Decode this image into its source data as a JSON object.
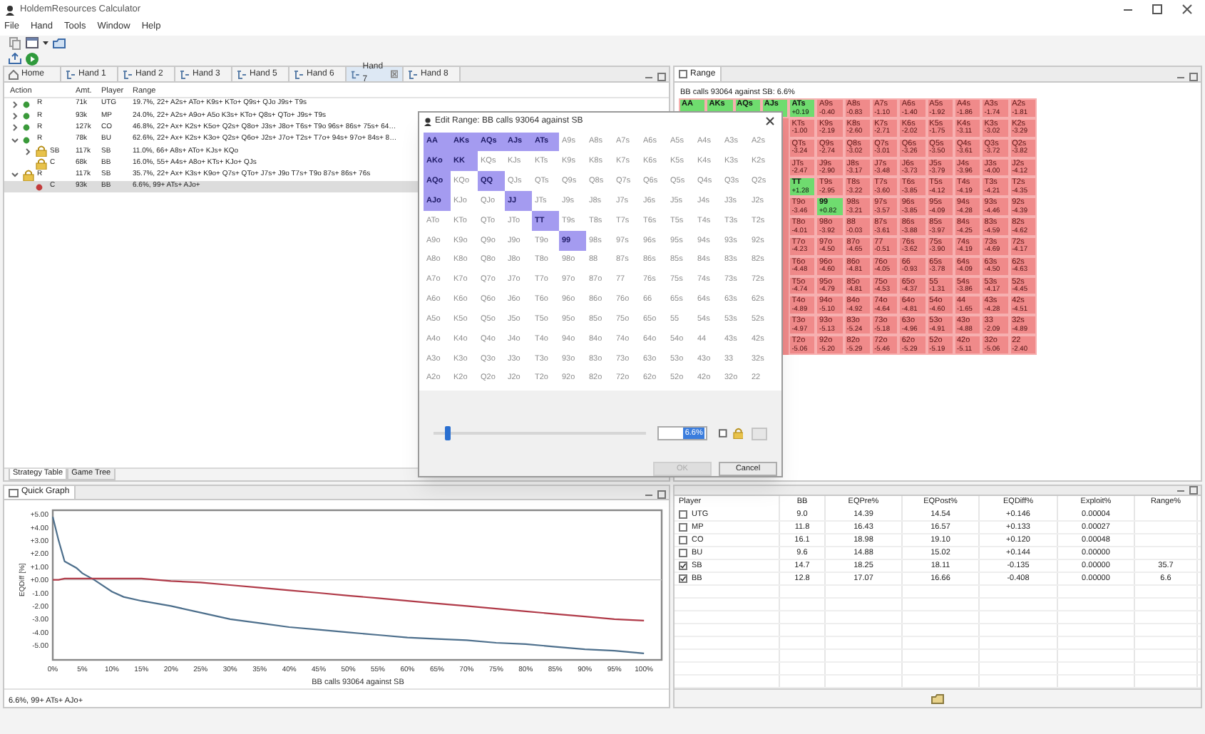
{
  "window": {
    "title": "HoldemResources Calculator"
  },
  "menu": [
    "File",
    "Hand",
    "Tools",
    "Window",
    "Help"
  ],
  "tabs": [
    {
      "label": "Home",
      "kind": "home",
      "selected": false
    },
    {
      "label": "Hand 1",
      "kind": "hand",
      "selected": false
    },
    {
      "label": "Hand 2",
      "kind": "hand",
      "selected": false
    },
    {
      "label": "Hand 3",
      "kind": "hand",
      "selected": false
    },
    {
      "label": "Hand 5",
      "kind": "hand",
      "selected": false
    },
    {
      "label": "Hand 6",
      "kind": "hand",
      "selected": false
    },
    {
      "label": "Hand 7",
      "kind": "hand",
      "selected": true
    },
    {
      "label": "Hand 8",
      "kind": "hand",
      "selected": false
    }
  ],
  "tree": {
    "columns": [
      "Action",
      "Amt.",
      "Player",
      "Range"
    ],
    "nodes": [
      {
        "action": "R",
        "amount": "71k",
        "player": "UTG",
        "range": "19.7%, 22+ A2s+ ATo+ K9s+ KTo+ Q9s+ QJo J9s+ T9s",
        "kind": "dot",
        "color": "#3a9a3a",
        "expanded": false,
        "selected": false
      },
      {
        "action": "R",
        "amount": "93k",
        "player": "MP",
        "range": "24.0%, 22+ A2s+ A9o+ A5o K3s+ KTo+ Q8s+ QTo+ J9s+ T9s",
        "kind": "dot",
        "color": "#3a9a3a",
        "expanded": false,
        "selected": false
      },
      {
        "action": "R",
        "amount": "127k",
        "player": "CO",
        "range": "46.8%, 22+ Ax+ K2s+ K5o+ Q2s+ Q8o+ J3s+ J8o+ T6s+ T9o 96s+ 86s+ 75s+ 64…",
        "kind": "dot",
        "color": "#3a9a3a",
        "expanded": false,
        "selected": false
      },
      {
        "action": "R",
        "amount": "78k",
        "player": "BU",
        "range": "62.6%, 22+ Ax+ K2s+ K3o+ Q2s+ Q6o+ J2s+ J7o+ T2s+ T7o+ 94s+ 97o+ 84s+ 8…",
        "kind": "dot",
        "color": "#3a9a3a",
        "expanded": true,
        "selected": false,
        "children": [
          {
            "action": "SB",
            "amount": "117k",
            "player": "SB",
            "range": "11.0%, 66+ A8s+ ATo+ KJs+ KQo",
            "kind": "lock",
            "expanded": false,
            "selected": false
          },
          {
            "action": "C",
            "amount": "68k",
            "player": "BB",
            "range": "16.0%, 55+ A4s+ A8o+ KTs+ KJo+ QJs",
            "kind": "lock",
            "selected": false
          }
        ]
      },
      {
        "action": "R",
        "amount": "117k",
        "player": "SB",
        "range": "35.7%, 22+ Ax+ K3s+ K9o+ Q7s+ QTo+ J7s+ J9o T7s+ T9o 87s+ 86s+ 76s",
        "kind": "lock",
        "expanded": true,
        "selected": false,
        "children": [
          {
            "action": "C",
            "amount": "93k",
            "player": "BB",
            "range": "6.6%, 99+ ATs+ AJo+",
            "kind": "dot",
            "color": "#c23b3b",
            "selected": true
          }
        ]
      }
    ]
  },
  "bottom_tabs": [
    {
      "label": "Strategy Table",
      "selected": true
    },
    {
      "label": "Game Tree",
      "selected": false
    }
  ],
  "quick_graph": {
    "tab": "Quick Graph",
    "chart_data": {
      "type": "line",
      "xlabel": "BB calls 93064 against SB",
      "ylabel": "EQDiff [%]",
      "x": [
        0,
        1,
        2,
        4,
        5,
        7,
        10,
        12,
        15,
        20,
        25,
        30,
        35,
        40,
        45,
        50,
        55,
        60,
        65,
        70,
        75,
        80,
        85,
        90,
        95,
        100
      ],
      "series": [
        {
          "color": "#4d6f8c",
          "values": [
            4.8,
            3.0,
            1.4,
            0.9,
            0.5,
            0.0,
            -0.9,
            -1.3,
            -1.6,
            -2.0,
            -2.5,
            -3.0,
            -3.3,
            -3.6,
            -3.8,
            -4.0,
            -4.2,
            -4.4,
            -4.5,
            -4.6,
            -4.8,
            -4.9,
            -5.1,
            -5.3,
            -5.4,
            -5.6
          ]
        },
        {
          "color": "#b03a48",
          "values": [
            0.0,
            0.0,
            0.1,
            0.1,
            0.1,
            0.1,
            0.1,
            0.1,
            0.1,
            -0.1,
            -0.2,
            -0.4,
            -0.6,
            -0.8,
            -1.0,
            -1.2,
            -1.4,
            -1.6,
            -1.8,
            -2.0,
            -2.2,
            -2.4,
            -2.6,
            -2.8,
            -3.0,
            -3.1
          ]
        }
      ],
      "xlim": [
        0,
        103
      ],
      "ylim": [
        -6.1,
        5.3
      ],
      "xticks": [
        {
          "value": 0,
          "label": "0%"
        },
        {
          "value": 5,
          "label": "5%"
        },
        {
          "value": 10,
          "label": "10%"
        },
        {
          "value": 15,
          "label": "15%"
        },
        {
          "value": 20,
          "label": "20%"
        },
        {
          "value": 25,
          "label": "25%"
        },
        {
          "value": 30,
          "label": "30%"
        },
        {
          "value": 35,
          "label": "35%"
        },
        {
          "value": 40,
          "label": "40%"
        },
        {
          "value": 45,
          "label": "45%"
        },
        {
          "value": 50,
          "label": "50%"
        },
        {
          "value": 55,
          "label": "55%"
        },
        {
          "value": 60,
          "label": "60%"
        },
        {
          "value": 65,
          "label": "65%"
        },
        {
          "value": 70,
          "label": "70%"
        },
        {
          "value": 75,
          "label": "75%"
        },
        {
          "value": 80,
          "label": "80%"
        },
        {
          "value": 85,
          "label": "85%"
        },
        {
          "value": 90,
          "label": "90%"
        },
        {
          "value": 95,
          "label": "95%"
        },
        {
          "value": 100,
          "label": "100%"
        }
      ],
      "yticks": [
        {
          "value": 5,
          "label": "+5.00"
        },
        {
          "value": 4,
          "label": "+4.00"
        },
        {
          "value": 3,
          "label": "+3.00"
        },
        {
          "value": 2,
          "label": "+2.00"
        },
        {
          "value": 1,
          "label": "+1.00"
        },
        {
          "value": 0,
          "label": "+0.00"
        },
        {
          "value": -1,
          "label": "-1.00"
        },
        {
          "value": -2,
          "label": "-2.00"
        },
        {
          "value": -3,
          "label": "-3.00"
        },
        {
          "value": -4,
          "label": "-4.00"
        },
        {
          "value": -5,
          "label": "-5.00"
        }
      ]
    }
  },
  "status_text": "6.6%, 99+ ATs+ AJo+",
  "range_panel": {
    "tab": "Range",
    "subtitle": "BB calls 93064 against SB: 6.6%",
    "rows": [
      [
        {
          "hand": "AA",
          "selected": true
        },
        {
          "hand": "AKs",
          "selected": true
        },
        {
          "hand": "AQs",
          "selected": true
        },
        {
          "hand": "AJs",
          "selected": true
        },
        {
          "hand": "ATs",
          "ev": "+0.19",
          "selected": true
        },
        {
          "hand": "A9s",
          "ev": "-0.40",
          "selected": false
        },
        {
          "hand": "A8s",
          "ev": "-0.83",
          "selected": false
        },
        {
          "hand": "A7s",
          "ev": "-1.10",
          "selected": false
        },
        {
          "hand": "A6s",
          "ev": "-1.40",
          "selected": false
        },
        {
          "hand": "A5s",
          "ev": "-1.92",
          "selected": false
        },
        {
          "hand": "A4s",
          "ev": "-1.86",
          "selected": false
        },
        {
          "hand": "A3s",
          "ev": "-1.74",
          "selected": false
        },
        {
          "hand": "A2s",
          "ev": "-1.81",
          "selected": false
        }
      ],
      [
        "",
        "",
        "",
        "",
        {
          "hand": "KTs",
          "ev": "-1.00",
          "selected": false
        },
        {
          "hand": "K9s",
          "ev": "-2.19",
          "selected": false
        },
        {
          "hand": "K8s",
          "ev": "-2.60",
          "selected": false
        },
        {
          "hand": "K7s",
          "ev": "-2.71",
          "selected": false
        },
        {
          "hand": "K6s",
          "ev": "-2.02",
          "selected": false
        },
        {
          "hand": "K5s",
          "ev": "-1.75",
          "selected": false
        },
        {
          "hand": "K4s",
          "ev": "-3.11",
          "selected": false
        },
        {
          "hand": "K3s",
          "ev": "-3.02",
          "selected": false
        },
        {
          "hand": "K2s",
          "ev": "-3.29",
          "selected": false
        }
      ],
      [
        "",
        "",
        "",
        "",
        {
          "hand": "QTs",
          "ev": "-3.24",
          "selected": false
        },
        {
          "hand": "Q9s",
          "ev": "-2.74",
          "selected": false
        },
        {
          "hand": "Q8s",
          "ev": "-3.02",
          "selected": false
        },
        {
          "hand": "Q7s",
          "ev": "-3.01",
          "selected": false
        },
        {
          "hand": "Q6s",
          "ev": "-3.26",
          "selected": false
        },
        {
          "hand": "Q5s",
          "ev": "-3.50",
          "selected": false
        },
        {
          "hand": "Q4s",
          "ev": "-3.61",
          "selected": false
        },
        {
          "hand": "Q3s",
          "ev": "-3.72",
          "selected": false
        },
        {
          "hand": "Q2s",
          "ev": "-3.82",
          "selected": false
        }
      ],
      [
        "",
        "",
        "",
        "",
        {
          "hand": "JTs",
          "ev": "-2.47",
          "selected": false
        },
        {
          "hand": "J9s",
          "ev": "-2.90",
          "selected": false
        },
        {
          "hand": "J8s",
          "ev": "-3.17",
          "selected": false
        },
        {
          "hand": "J7s",
          "ev": "-3.48",
          "selected": false
        },
        {
          "hand": "J6s",
          "ev": "-3.73",
          "selected": false
        },
        {
          "hand": "J5s",
          "ev": "-3.79",
          "selected": false
        },
        {
          "hand": "J4s",
          "ev": "-3.96",
          "selected": false
        },
        {
          "hand": "J3s",
          "ev": "-4.00",
          "selected": false
        },
        {
          "hand": "J2s",
          "ev": "-4.12",
          "selected": false
        }
      ],
      [
        "",
        "",
        "",
        "",
        {
          "hand": "TT",
          "ev": "+1.28",
          "selected": true
        },
        {
          "hand": "T9s",
          "ev": "-2.95",
          "selected": false
        },
        {
          "hand": "T8s",
          "ev": "-3.22",
          "selected": false
        },
        {
          "hand": "T7s",
          "ev": "-3.60",
          "selected": false
        },
        {
          "hand": "T6s",
          "ev": "-3.85",
          "selected": false
        },
        {
          "hand": "T5s",
          "ev": "-4.12",
          "selected": false
        },
        {
          "hand": "T4s",
          "ev": "-4.19",
          "selected": false
        },
        {
          "hand": "T3s",
          "ev": "-4.21",
          "selected": false
        },
        {
          "hand": "T2s",
          "ev": "-4.35",
          "selected": false
        }
      ],
      [
        "",
        "",
        "",
        "",
        {
          "hand": "T9o",
          "ev": "-3.46",
          "selected": false
        },
        {
          "hand": "99",
          "ev": "+0.82",
          "selected": true
        },
        {
          "hand": "98s",
          "ev": "-3.21",
          "selected": false
        },
        {
          "hand": "97s",
          "ev": "-3.57",
          "selected": false
        },
        {
          "hand": "96s",
          "ev": "-3.85",
          "selected": false
        },
        {
          "hand": "95s",
          "ev": "-4.09",
          "selected": false
        },
        {
          "hand": "94s",
          "ev": "-4.28",
          "selected": false
        },
        {
          "hand": "93s",
          "ev": "-4.46",
          "selected": false
        },
        {
          "hand": "92s",
          "ev": "-4.39",
          "selected": false
        }
      ],
      [
        "",
        "",
        "",
        "",
        {
          "hand": "T8o",
          "ev": "-4.01",
          "selected": false
        },
        {
          "hand": "98o",
          "ev": "-3.92",
          "selected": false
        },
        {
          "hand": "88",
          "ev": "-0.03",
          "selected": false
        },
        {
          "hand": "87s",
          "ev": "-3.61",
          "selected": false
        },
        {
          "hand": "86s",
          "ev": "-3.88",
          "selected": false
        },
        {
          "hand": "85s",
          "ev": "-3.97",
          "selected": false
        },
        {
          "hand": "84s",
          "ev": "-4.25",
          "selected": false
        },
        {
          "hand": "83s",
          "ev": "-4.59",
          "selected": false
        },
        {
          "hand": "82s",
          "ev": "-4.62",
          "selected": false
        }
      ],
      [
        "",
        "",
        "",
        "",
        {
          "hand": "T7o",
          "ev": "-4.23",
          "selected": false
        },
        {
          "hand": "97o",
          "ev": "-4.50",
          "selected": false
        },
        {
          "hand": "87o",
          "ev": "-4.65",
          "selected": false
        },
        {
          "hand": "77",
          "ev": "-0.51",
          "selected": false
        },
        {
          "hand": "76s",
          "ev": "-3.62",
          "selected": false
        },
        {
          "hand": "75s",
          "ev": "-3.90",
          "selected": false
        },
        {
          "hand": "74s",
          "ev": "-4.19",
          "selected": false
        },
        {
          "hand": "73s",
          "ev": "-4.69",
          "selected": false
        },
        {
          "hand": "72s",
          "ev": "-4.17",
          "selected": false
        }
      ],
      [
        "",
        "",
        "",
        "",
        {
          "hand": "T6o",
          "ev": "-4.48",
          "selected": false
        },
        {
          "hand": "96o",
          "ev": "-4.60",
          "selected": false
        },
        {
          "hand": "86o",
          "ev": "-4.81",
          "selected": false
        },
        {
          "hand": "76o",
          "ev": "-4.05",
          "selected": false
        },
        {
          "hand": "66",
          "ev": "-0.93",
          "selected": false
        },
        {
          "hand": "65s",
          "ev": "-3.78",
          "selected": false
        },
        {
          "hand": "64s",
          "ev": "-4.09",
          "selected": false
        },
        {
          "hand": "63s",
          "ev": "-4.50",
          "selected": false
        },
        {
          "hand": "62s",
          "ev": "-4.63",
          "selected": false
        }
      ],
      [
        "",
        "",
        "",
        "",
        {
          "hand": "T5o",
          "ev": "-4.74",
          "selected": false
        },
        {
          "hand": "95o",
          "ev": "-4.79",
          "selected": false
        },
        {
          "hand": "85o",
          "ev": "-4.81",
          "selected": false
        },
        {
          "hand": "75o",
          "ev": "-4.53",
          "selected": false
        },
        {
          "hand": "65o",
          "ev": "-4.37",
          "selected": false
        },
        {
          "hand": "55",
          "ev": "-1.31",
          "selected": false
        },
        {
          "hand": "54s",
          "ev": "-3.86",
          "selected": false
        },
        {
          "hand": "53s",
          "ev": "-4.17",
          "selected": false
        },
        {
          "hand": "52s",
          "ev": "-4.45",
          "selected": false
        }
      ],
      [
        "",
        "",
        "",
        "",
        {
          "hand": "T4o",
          "ev": "-4.89",
          "selected": false
        },
        {
          "hand": "94o",
          "ev": "-5.10",
          "selected": false
        },
        {
          "hand": "84o",
          "ev": "-4.92",
          "selected": false
        },
        {
          "hand": "74o",
          "ev": "-4.64",
          "selected": false
        },
        {
          "hand": "64o",
          "ev": "-4.81",
          "selected": false
        },
        {
          "hand": "54o",
          "ev": "-4.60",
          "selected": false
        },
        {
          "hand": "44",
          "ev": "-1.65",
          "selected": false
        },
        {
          "hand": "43s",
          "ev": "-4.28",
          "selected": false
        },
        {
          "hand": "42s",
          "ev": "-4.51",
          "selected": false
        }
      ],
      [
        "",
        "",
        "",
        "",
        {
          "hand": "T3o",
          "ev": "-4.97",
          "selected": false
        },
        {
          "hand": "93o",
          "ev": "-5.13",
          "selected": false
        },
        {
          "hand": "83o",
          "ev": "-5.24",
          "selected": false
        },
        {
          "hand": "73o",
          "ev": "-5.18",
          "selected": false
        },
        {
          "hand": "63o",
          "ev": "-4.96",
          "selected": false
        },
        {
          "hand": "53o",
          "ev": "-4.91",
          "selected": false
        },
        {
          "hand": "43o",
          "ev": "-4.88",
          "selected": false
        },
        {
          "hand": "33",
          "ev": "-2.09",
          "selected": false
        },
        {
          "hand": "32s",
          "ev": "-4.89",
          "selected": false
        }
      ],
      [
        "",
        "",
        "",
        "",
        {
          "hand": "T2o",
          "ev": "-5.06",
          "selected": false
        },
        {
          "hand": "92o",
          "ev": "-5.20",
          "selected": false
        },
        {
          "hand": "82o",
          "ev": "-5.29",
          "selected": false
        },
        {
          "hand": "72o",
          "ev": "-5.46",
          "selected": false
        },
        {
          "hand": "62o",
          "ev": "-5.29",
          "selected": false
        },
        {
          "hand": "52o",
          "ev": "-5.19",
          "selected": false
        },
        {
          "hand": "42o",
          "ev": "-5.11",
          "selected": false
        },
        {
          "hand": "32o",
          "ev": "-5.06",
          "selected": false
        },
        {
          "hand": "22",
          "ev": "-2.40",
          "selected": false
        }
      ]
    ]
  },
  "stats_table": {
    "columns": [
      "Player",
      "BB",
      "EQPre%",
      "EQPost%",
      "EQDiff%",
      "Exploit%",
      "Range%"
    ],
    "rows": [
      {
        "checked": false,
        "cells": [
          "UTG",
          "9.0",
          "14.39",
          "14.54",
          "+0.146",
          "0.00004",
          ""
        ]
      },
      {
        "checked": false,
        "cells": [
          "MP",
          "11.8",
          "16.43",
          "16.57",
          "+0.133",
          "0.00027",
          ""
        ]
      },
      {
        "checked": false,
        "cells": [
          "CO",
          "16.1",
          "18.98",
          "19.10",
          "+0.120",
          "0.00048",
          ""
        ]
      },
      {
        "checked": false,
        "cells": [
          "BU",
          "9.6",
          "14.88",
          "15.02",
          "+0.144",
          "0.00000",
          ""
        ]
      },
      {
        "checked": true,
        "cells": [
          "SB",
          "14.7",
          "18.25",
          "18.11",
          "-0.135",
          "0.00000",
          "35.7"
        ]
      },
      {
        "checked": true,
        "cells": [
          "BB",
          "12.8",
          "17.07",
          "16.66",
          "-0.408",
          "0.00000",
          "6.6"
        ]
      }
    ]
  },
  "dialog": {
    "title": "Edit Range: BB calls 93064 against SB",
    "slider": {
      "level": 0.05
    },
    "percent": "6.6%",
    "lock_checked": false,
    "ok_disabled": true,
    "buttons": [
      "OK",
      "Cancel"
    ],
    "grid": [
      [
        {
          "hand": "AA",
          "selected": true
        },
        {
          "hand": "AKs",
          "selected": true
        },
        {
          "hand": "AQs",
          "selected": true
        },
        {
          "hand": "AJs",
          "selected": true
        },
        {
          "hand": "ATs",
          "selected": true
        },
        {
          "hand": "A9s",
          "selected": false
        },
        {
          "hand": "A8s",
          "selected": false
        },
        {
          "hand": "A7s",
          "selected": false
        },
        {
          "hand": "A6s",
          "selected": false
        },
        {
          "hand": "A5s",
          "selected": false
        },
        {
          "hand": "A4s",
          "selected": false
        },
        {
          "hand": "A3s",
          "selected": false
        },
        {
          "hand": "A2s",
          "selected": false
        }
      ],
      [
        {
          "hand": "AKo",
          "selected": true
        },
        {
          "hand": "KK",
          "selected": true
        },
        {
          "hand": "KQs",
          "selected": false
        },
        {
          "hand": "KJs",
          "selected": false
        },
        {
          "hand": "KTs",
          "selected": false
        },
        {
          "hand": "K9s",
          "selected": false
        },
        {
          "hand": "K8s",
          "selected": false
        },
        {
          "hand": "K7s",
          "selected": false
        },
        {
          "hand": "K6s",
          "selected": false
        },
        {
          "hand": "K5s",
          "selected": false
        },
        {
          "hand": "K4s",
          "selected": false
        },
        {
          "hand": "K3s",
          "selected": false
        },
        {
          "hand": "K2s",
          "selected": false
        }
      ],
      [
        {
          "hand": "AQo",
          "selected": true
        },
        {
          "hand": "KQo",
          "selected": false
        },
        {
          "hand": "QQ",
          "selected": true
        },
        {
          "hand": "QJs",
          "selected": false
        },
        {
          "hand": "QTs",
          "selected": false
        },
        {
          "hand": "Q9s",
          "selected": false
        },
        {
          "hand": "Q8s",
          "selected": false
        },
        {
          "hand": "Q7s",
          "selected": false
        },
        {
          "hand": "Q6s",
          "selected": false
        },
        {
          "hand": "Q5s",
          "selected": false
        },
        {
          "hand": "Q4s",
          "selected": false
        },
        {
          "hand": "Q3s",
          "selected": false
        },
        {
          "hand": "Q2s",
          "selected": false
        }
      ],
      [
        {
          "hand": "AJo",
          "selected": true
        },
        {
          "hand": "KJo",
          "selected": false
        },
        {
          "hand": "QJo",
          "selected": false
        },
        {
          "hand": "JJ",
          "selected": true
        },
        {
          "hand": "JTs",
          "selected": false
        },
        {
          "hand": "J9s",
          "selected": false
        },
        {
          "hand": "J8s",
          "selected": false
        },
        {
          "hand": "J7s",
          "selected": false
        },
        {
          "hand": "J6s",
          "selected": false
        },
        {
          "hand": "J5s",
          "selected": false
        },
        {
          "hand": "J4s",
          "selected": false
        },
        {
          "hand": "J3s",
          "selected": false
        },
        {
          "hand": "J2s",
          "selected": false
        }
      ],
      [
        {
          "hand": "ATo",
          "selected": false
        },
        {
          "hand": "KTo",
          "selected": false
        },
        {
          "hand": "QTo",
          "selected": false
        },
        {
          "hand": "JTo",
          "selected": false
        },
        {
          "hand": "TT",
          "selected": true
        },
        {
          "hand": "T9s",
          "selected": false
        },
        {
          "hand": "T8s",
          "selected": false
        },
        {
          "hand": "T7s",
          "selected": false
        },
        {
          "hand": "T6s",
          "selected": false
        },
        {
          "hand": "T5s",
          "selected": false
        },
        {
          "hand": "T4s",
          "selected": false
        },
        {
          "hand": "T3s",
          "selected": false
        },
        {
          "hand": "T2s",
          "selected": false
        }
      ],
      [
        {
          "hand": "A9o",
          "selected": false
        },
        {
          "hand": "K9o",
          "selected": false
        },
        {
          "hand": "Q9o",
          "selected": false
        },
        {
          "hand": "J9o",
          "selected": false
        },
        {
          "hand": "T9o",
          "selected": false
        },
        {
          "hand": "99",
          "selected": true
        },
        {
          "hand": "98s",
          "selected": false
        },
        {
          "hand": "97s",
          "selected": false
        },
        {
          "hand": "96s",
          "selected": false
        },
        {
          "hand": "95s",
          "selected": false
        },
        {
          "hand": "94s",
          "selected": false
        },
        {
          "hand": "93s",
          "selected": false
        },
        {
          "hand": "92s",
          "selected": false
        }
      ],
      [
        {
          "hand": "A8o",
          "selected": false
        },
        {
          "hand": "K8o",
          "selected": false
        },
        {
          "hand": "Q8o",
          "selected": false
        },
        {
          "hand": "J8o",
          "selected": false
        },
        {
          "hand": "T8o",
          "selected": false
        },
        {
          "hand": "98o",
          "selected": false
        },
        {
          "hand": "88",
          "selected": false
        },
        {
          "hand": "87s",
          "selected": false
        },
        {
          "hand": "86s",
          "selected": false
        },
        {
          "hand": "85s",
          "selected": false
        },
        {
          "hand": "84s",
          "selected": false
        },
        {
          "hand": "83s",
          "selected": false
        },
        {
          "hand": "82s",
          "selected": false
        }
      ],
      [
        {
          "hand": "A7o",
          "selected": false
        },
        {
          "hand": "K7o",
          "selected": false
        },
        {
          "hand": "Q7o",
          "selected": false
        },
        {
          "hand": "J7o",
          "selected": false
        },
        {
          "hand": "T7o",
          "selected": false
        },
        {
          "hand": "97o",
          "selected": false
        },
        {
          "hand": "87o",
          "selected": false
        },
        {
          "hand": "77",
          "selected": false
        },
        {
          "hand": "76s",
          "selected": false
        },
        {
          "hand": "75s",
          "selected": false
        },
        {
          "hand": "74s",
          "selected": false
        },
        {
          "hand": "73s",
          "selected": false
        },
        {
          "hand": "72s",
          "selected": false
        }
      ],
      [
        {
          "hand": "A6o",
          "selected": false
        },
        {
          "hand": "K6o",
          "selected": false
        },
        {
          "hand": "Q6o",
          "selected": false
        },
        {
          "hand": "J6o",
          "selected": false
        },
        {
          "hand": "T6o",
          "selected": false
        },
        {
          "hand": "96o",
          "selected": false
        },
        {
          "hand": "86o",
          "selected": false
        },
        {
          "hand": "76o",
          "selected": false
        },
        {
          "hand": "66",
          "selected": false
        },
        {
          "hand": "65s",
          "selected": false
        },
        {
          "hand": "64s",
          "selected": false
        },
        {
          "hand": "63s",
          "selected": false
        },
        {
          "hand": "62s",
          "selected": false
        }
      ],
      [
        {
          "hand": "A5o",
          "selected": false
        },
        {
          "hand": "K5o",
          "selected": false
        },
        {
          "hand": "Q5o",
          "selected": false
        },
        {
          "hand": "J5o",
          "selected": false
        },
        {
          "hand": "T5o",
          "selected": false
        },
        {
          "hand": "95o",
          "selected": false
        },
        {
          "hand": "85o",
          "selected": false
        },
        {
          "hand": "75o",
          "selected": false
        },
        {
          "hand": "65o",
          "selected": false
        },
        {
          "hand": "55",
          "selected": false
        },
        {
          "hand": "54s",
          "selected": false
        },
        {
          "hand": "53s",
          "selected": false
        },
        {
          "hand": "52s",
          "selected": false
        }
      ],
      [
        {
          "hand": "A4o",
          "selected": false
        },
        {
          "hand": "K4o",
          "selected": false
        },
        {
          "hand": "Q4o",
          "selected": false
        },
        {
          "hand": "J4o",
          "selected": false
        },
        {
          "hand": "T4o",
          "selected": false
        },
        {
          "hand": "94o",
          "selected": false
        },
        {
          "hand": "84o",
          "selected": false
        },
        {
          "hand": "74o",
          "selected": false
        },
        {
          "hand": "64o",
          "selected": false
        },
        {
          "hand": "54o",
          "selected": false
        },
        {
          "hand": "44",
          "selected": false
        },
        {
          "hand": "43s",
          "selected": false
        },
        {
          "hand": "42s",
          "selected": false
        }
      ],
      [
        {
          "hand": "A3o",
          "selected": false
        },
        {
          "hand": "K3o",
          "selected": false
        },
        {
          "hand": "Q3o",
          "selected": false
        },
        {
          "hand": "J3o",
          "selected": false
        },
        {
          "hand": "T3o",
          "selected": false
        },
        {
          "hand": "93o",
          "selected": false
        },
        {
          "hand": "83o",
          "selected": false
        },
        {
          "hand": "73o",
          "selected": false
        },
        {
          "hand": "63o",
          "selected": false
        },
        {
          "hand": "53o",
          "selected": false
        },
        {
          "hand": "43o",
          "selected": false
        },
        {
          "hand": "33",
          "selected": false
        },
        {
          "hand": "32s",
          "selected": false
        }
      ],
      [
        {
          "hand": "A2o",
          "selected": false
        },
        {
          "hand": "K2o",
          "selected": false
        },
        {
          "hand": "Q2o",
          "selected": false
        },
        {
          "hand": "J2o",
          "selected": false
        },
        {
          "hand": "T2o",
          "selected": false
        },
        {
          "hand": "92o",
          "selected": false
        },
        {
          "hand": "82o",
          "selected": false
        },
        {
          "hand": "72o",
          "selected": false
        },
        {
          "hand": "62o",
          "selected": false
        },
        {
          "hand": "52o",
          "selected": false
        },
        {
          "hand": "42o",
          "selected": false
        },
        {
          "hand": "32o",
          "selected": false
        },
        {
          "hand": "22",
          "selected": false
        }
      ]
    ]
  }
}
